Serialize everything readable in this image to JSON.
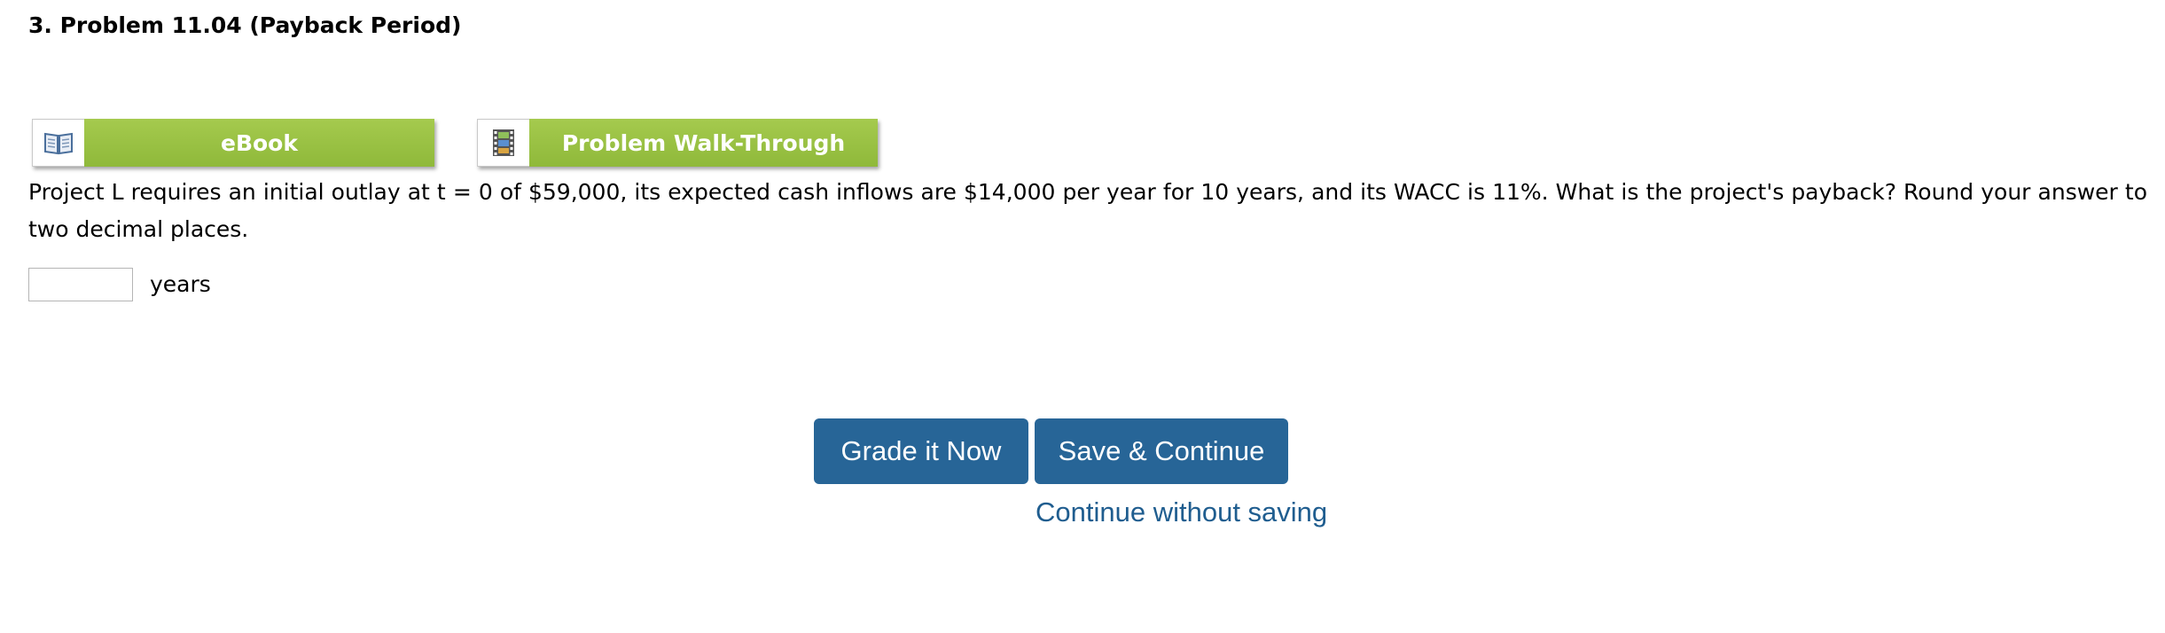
{
  "problem": {
    "title": "3.  Problem 11.04 (Payback Period)"
  },
  "resources": {
    "ebook_label": "eBook",
    "walkthrough_label": "Problem Walk-Through",
    "accent_color": "#97c043"
  },
  "question": {
    "text": "Project L requires an initial outlay at t = 0 of $59,000, its expected cash inflows are $14,000 per year for 10 years, and its WACC is 11%. What is the project's payback? Round your answer to two decimal places.",
    "answer_value": "",
    "unit": "years"
  },
  "actions": {
    "grade_label": "Grade it Now",
    "save_label": "Save & Continue",
    "continue_label": "Continue without saving",
    "button_color": "#276597"
  }
}
